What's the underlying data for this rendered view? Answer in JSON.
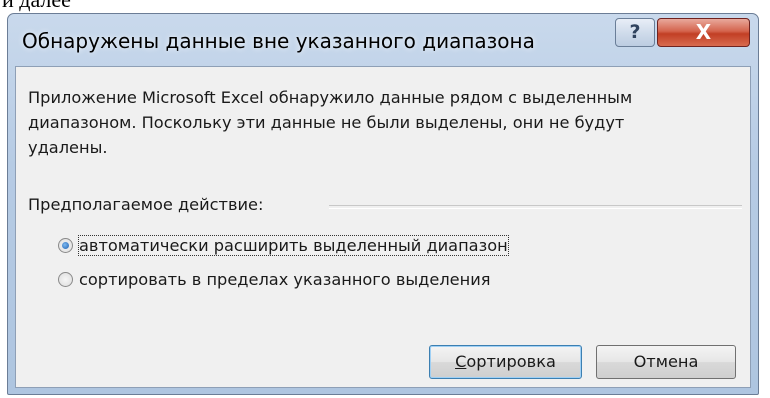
{
  "top_fragment": "и далее",
  "dialog": {
    "title": "Обнаружены данные вне указанного диапазона",
    "help_symbol": "?",
    "close_symbol": "X",
    "message_lines": [
      "Приложение Microsoft Excel обнаружило данные рядом с выделенным",
      "диапазоном. Поскольку эти данные не были выделены, они не будут",
      "удалены."
    ],
    "group_label": "Предполагаемое действие:",
    "options": [
      {
        "label": "автоматически расширить выделенный диапазон",
        "checked": true
      },
      {
        "label": "сортировать в пределах указанного выделения",
        "checked": false
      }
    ],
    "buttons": {
      "sort": "Сортировка",
      "cancel": "Отмена"
    }
  },
  "colors": {
    "frame": "#b6cbe4",
    "client": "#f0f0f0",
    "close_button": "#c23f25",
    "radio_selected": "#1d5fb0"
  }
}
